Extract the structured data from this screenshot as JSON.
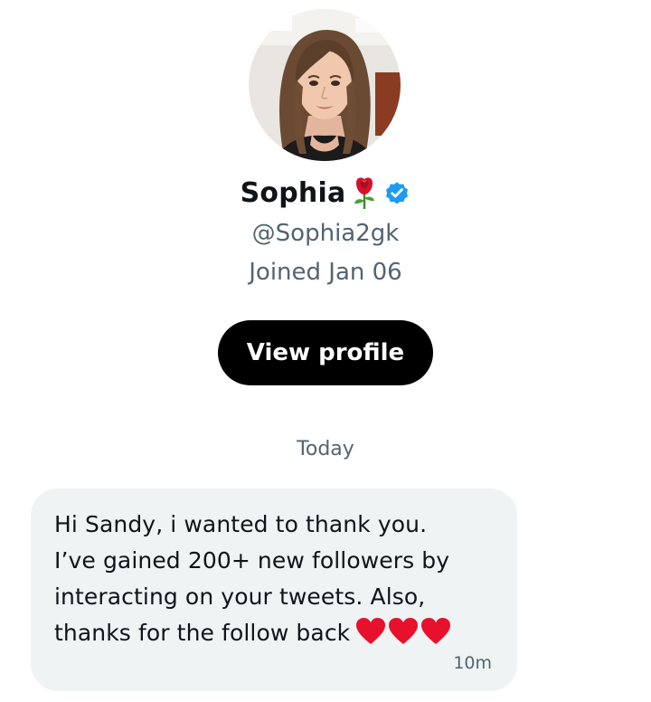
{
  "profile": {
    "name": "Sophia",
    "handle": "@Sophia2gk",
    "joined": "Joined Jan 06",
    "name_emoji_icon": "rose-icon",
    "verified_icon": "verified-badge-icon",
    "verified_color": "#1d9bf0",
    "view_profile_label": "View profile"
  },
  "conversation": {
    "day_separator": "Today",
    "messages": [
      {
        "text": "Hi Sandy, i wanted to thank you.\nI’ve gained 200+ new followers by\ninteracting on your tweets. Also,\nthanks for the follow back",
        "reaction_icons": [
          "heart-icon",
          "heart-icon",
          "heart-icon"
        ],
        "time": "10m"
      }
    ]
  },
  "colors": {
    "text_primary": "#0f1419",
    "text_secondary": "#536471",
    "bubble_bg": "#eff3f4",
    "button_bg": "#000000",
    "heart": "#e8112d"
  }
}
